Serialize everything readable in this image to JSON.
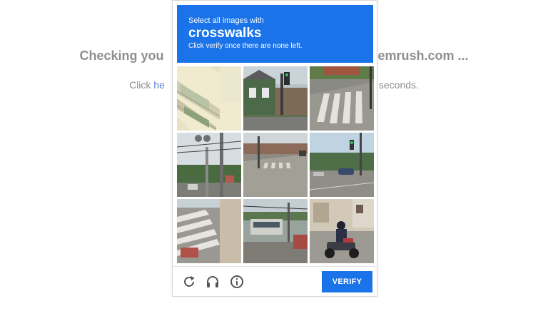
{
  "background_page": {
    "heading": "Checking you                                      emrush.com ...",
    "heading_left": "Checking you",
    "heading_right": "emrush.com ...",
    "sub_prefix": "Click ",
    "sub_link": "he",
    "sub_suffix": "seconds."
  },
  "captcha": {
    "prompt": "Select all images with",
    "keyword": "crosswalks",
    "hint": "Click verify once there are none left.",
    "verify_label": "VERIFY",
    "icons": [
      "reload-icon",
      "audio-headphones-icon",
      "info-icon"
    ],
    "tiles": [
      {
        "name": "tile-building-balcony"
      },
      {
        "name": "tile-house-traffic-light"
      },
      {
        "name": "tile-street-crosswalk"
      },
      {
        "name": "tile-utility-poles"
      },
      {
        "name": "tile-intersection-crosswalk"
      },
      {
        "name": "tile-road-traffic-light"
      },
      {
        "name": "tile-street-zebra-crossing"
      },
      {
        "name": "tile-tram-street"
      },
      {
        "name": "tile-motorcycle-rider"
      }
    ],
    "accent_color": "#1a73e8"
  }
}
